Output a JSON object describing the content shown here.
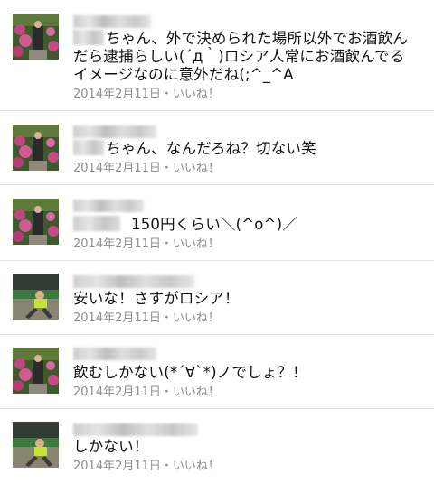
{
  "comments": [
    {
      "text": "ちゃん、外で決められた場所以外でお酒飲んだら逮捕らしい(´д｀)ロシア人常にお酒飲んでるイメージなのに意外だね(;^_^A",
      "date": "2014年2月11日",
      "separator": "・",
      "like": "いいね！",
      "avatar": "flowers-avatar"
    },
    {
      "text": "ちゃん、なんだろね？切ない笑",
      "date": "2014年2月11日",
      "separator": "・",
      "like": "いいね！",
      "avatar": "flowers-avatar"
    },
    {
      "text": "150円くらい＼(^o^)／",
      "date": "2014年2月11日",
      "separator": "・",
      "like": "いいね！",
      "avatar": "flowers-avatar"
    },
    {
      "text": "安いな！さすがロシア！",
      "date": "2014年2月11日",
      "separator": "・",
      "like": "いいね！",
      "avatar": "runner-avatar"
    },
    {
      "text": "飲むしかない(*´∀`*)ノでしょ？！",
      "date": "2014年2月11日",
      "separator": "・",
      "like": "いいね！",
      "avatar": "flowers-avatar"
    },
    {
      "text": "しかない！",
      "date": "2014年2月11日",
      "separator": "・",
      "like": "いいね！",
      "avatar": "runner-avatar"
    }
  ]
}
